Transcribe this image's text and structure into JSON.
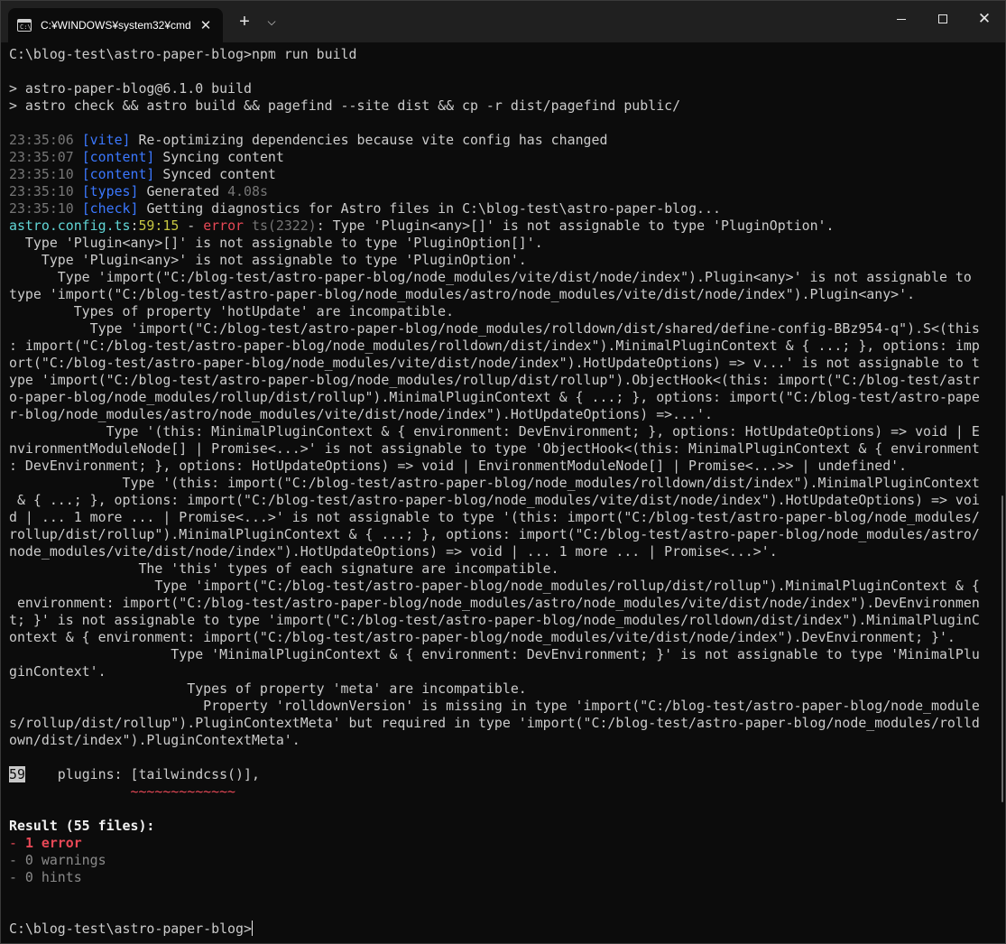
{
  "window": {
    "tab_title": "C:¥WINDOWS¥system32¥cmd",
    "tab_icon_text": "C:\\",
    "close_tab": "✕",
    "new_tab": "+",
    "dropdown": "⌵",
    "close_window": "✕"
  },
  "terminal": {
    "cmd_prompt": "C:\\blog-test\\astro-paper-blog>",
    "cmd_input": "npm run build",
    "script_line1": "> astro-paper-blog@6.1.0 build",
    "script_line2": "> astro check && astro build && pagefind --site dist && cp -r dist/pagefind public/",
    "logs": [
      {
        "time": "23:35:06",
        "tag": "[vite]",
        "msg": "Re-optimizing dependencies because vite config has changed",
        "extra": ""
      },
      {
        "time": "23:35:07",
        "tag": "[content]",
        "msg": "Syncing content",
        "extra": ""
      },
      {
        "time": "23:35:10",
        "tag": "[content]",
        "msg": "Synced content",
        "extra": ""
      },
      {
        "time": "23:35:10",
        "tag": "[types]",
        "msg": "Generated",
        "extra": "4.08s"
      },
      {
        "time": "23:35:10",
        "tag": "[check]",
        "msg": "Getting diagnostics for Astro files in C:\\blog-test\\astro-paper-blog...",
        "extra": ""
      }
    ],
    "error_header": {
      "file": "astro.config.ts",
      "position": "59:15",
      "dash": " - ",
      "label": "error",
      "code": "ts(2322)",
      "message": ": Type 'Plugin<any>[]' is not assignable to type 'PluginOption'."
    },
    "error_lines": [
      "  Type 'Plugin<any>[]' is not assignable to type 'PluginOption[]'.",
      "    Type 'Plugin<any>' is not assignable to type 'PluginOption'.",
      "      Type 'import(\"C:/blog-test/astro-paper-blog/node_modules/vite/dist/node/index\").Plugin<any>' is not assignable to",
      "type 'import(\"C:/blog-test/astro-paper-blog/node_modules/astro/node_modules/vite/dist/node/index\").Plugin<any>'.",
      "        Types of property 'hotUpdate' are incompatible.",
      "          Type 'import(\"C:/blog-test/astro-paper-blog/node_modules/rolldown/dist/shared/define-config-BBz954-q\").S<(this",
      ": import(\"C:/blog-test/astro-paper-blog/node_modules/rolldown/dist/index\").MinimalPluginContext & { ...; }, options: imp",
      "ort(\"C:/blog-test/astro-paper-blog/node_modules/vite/dist/node/index\").HotUpdateOptions) => v...' is not assignable to t",
      "ype 'import(\"C:/blog-test/astro-paper-blog/node_modules/rollup/dist/rollup\").ObjectHook<(this: import(\"C:/blog-test/astr",
      "o-paper-blog/node_modules/rollup/dist/rollup\").MinimalPluginContext & { ...; }, options: import(\"C:/blog-test/astro-pape",
      "r-blog/node_modules/astro/node_modules/vite/dist/node/index\").HotUpdateOptions) =>...'.",
      "            Type '(this: MinimalPluginContext & { environment: DevEnvironment; }, options: HotUpdateOptions) => void | E",
      "nvironmentModuleNode[] | Promise<...>' is not assignable to type 'ObjectHook<(this: MinimalPluginContext & { environment",
      ": DevEnvironment; }, options: HotUpdateOptions) => void | EnvironmentModuleNode[] | Promise<...>> | undefined'.",
      "              Type '(this: import(\"C:/blog-test/astro-paper-blog/node_modules/rolldown/dist/index\").MinimalPluginContext",
      " & { ...; }, options: import(\"C:/blog-test/astro-paper-blog/node_modules/vite/dist/node/index\").HotUpdateOptions) => voi",
      "d | ... 1 more ... | Promise<...>' is not assignable to type '(this: import(\"C:/blog-test/astro-paper-blog/node_modules/",
      "rollup/dist/rollup\").MinimalPluginContext & { ...; }, options: import(\"C:/blog-test/astro-paper-blog/node_modules/astro/",
      "node_modules/vite/dist/node/index\").HotUpdateOptions) => void | ... 1 more ... | Promise<...>'.",
      "                The 'this' types of each signature are incompatible.",
      "                  Type 'import(\"C:/blog-test/astro-paper-blog/node_modules/rollup/dist/rollup\").MinimalPluginContext & {",
      " environment: import(\"C:/blog-test/astro-paper-blog/node_modules/astro/node_modules/vite/dist/node/index\").DevEnvironmen",
      "t; }' is not assignable to type 'import(\"C:/blog-test/astro-paper-blog/node_modules/rolldown/dist/index\").MinimalPluginC",
      "ontext & { environment: import(\"C:/blog-test/astro-paper-blog/node_modules/vite/dist/node/index\").DevEnvironment; }'.",
      "                    Type 'MinimalPluginContext & { environment: DevEnvironment; }' is not assignable to type 'MinimalPlu",
      "ginContext'.",
      "                      Types of property 'meta' are incompatible.",
      "                        Property 'rolldownVersion' is missing in type 'import(\"C:/blog-test/astro-paper-blog/node_module",
      "s/rollup/dist/rollup\").PluginContextMeta' but required in type 'import(\"C:/blog-test/astro-paper-blog/node_modules/rolld",
      "own/dist/index\").PluginContextMeta'."
    ],
    "code_snippet": {
      "line_number": "59",
      "code": "    plugins: [tailwindcss()],",
      "squiggle": "             ~~~~~~~~~~~~~"
    },
    "result": {
      "header": "Result (55 files):",
      "errors_prefix": "- ",
      "errors": "1 error",
      "warnings": "- 0 warnings",
      "hints": "- 0 hints"
    },
    "final_prompt": "C:\\blog-test\\astro-paper-blog>"
  },
  "colors": {
    "background": "#0c0c0c",
    "titlebar": "#202020",
    "text": "#cccccc",
    "tag_blue": "#3b78ff",
    "file_cyan": "#61d6d6",
    "position_yellow": "#c7c742",
    "error_red": "#e74856",
    "timestamp_gray": "#767676"
  }
}
